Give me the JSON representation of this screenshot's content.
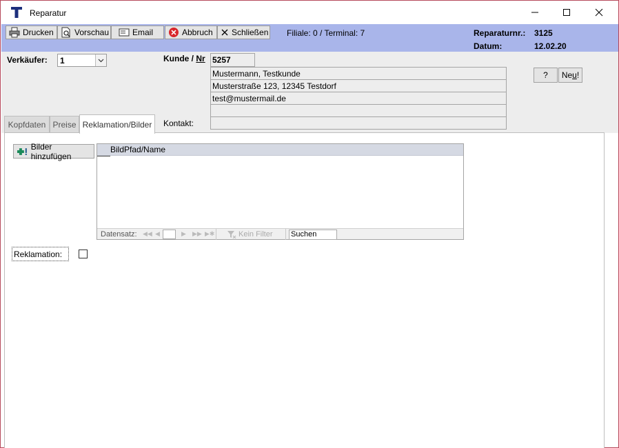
{
  "window": {
    "title": "Reparatur"
  },
  "toolbar": {
    "print_label": "Drucken",
    "preview_label": "Vorschau",
    "email_label": "Email",
    "cancel_label": "Abbruch",
    "close_label": "Schließen"
  },
  "header": {
    "branch_info": "Filiale: 0 / Terminal:  7",
    "repair_no_label": "Reparaturnr.:",
    "repair_no_value": "3125",
    "date_label": "Datum:",
    "date_value": "12.02.20"
  },
  "form": {
    "salesperson_label": "Verkäufer:",
    "salesperson_value": "1",
    "customer_label_prefix": "Kunde / ",
    "customer_label_underlined": "Nr",
    "customer_no": "5257",
    "customer_name": "Mustermann, Testkunde",
    "customer_address": "Musterstraße 123, 12345 Testdorf",
    "customer_email": "test@mustermail.de",
    "customer_line4": "",
    "contact_label": "Kontakt:",
    "contact_value": "",
    "help_button": "?",
    "new_button_prefix": "Ne",
    "new_button_underlined": "u",
    "new_button_suffix": "!"
  },
  "tabs": [
    {
      "label": "Kopfdaten"
    },
    {
      "label": "Preise"
    },
    {
      "label": "Reklamation/Bilder"
    }
  ],
  "images": {
    "add_button": "Bilder hinzufügen",
    "column_header": "BildPfad/Name",
    "nav_label": "Datensatz:",
    "nav_filter": "Kein Filter",
    "nav_search": "Suchen"
  },
  "complaint": {
    "label": "Reklamation:",
    "checked": false
  },
  "colors": {
    "header_band": "#a9b5ea",
    "form_background": "#ededed",
    "window_border": "#b5485a",
    "cancel_icon": "#d8262b"
  }
}
